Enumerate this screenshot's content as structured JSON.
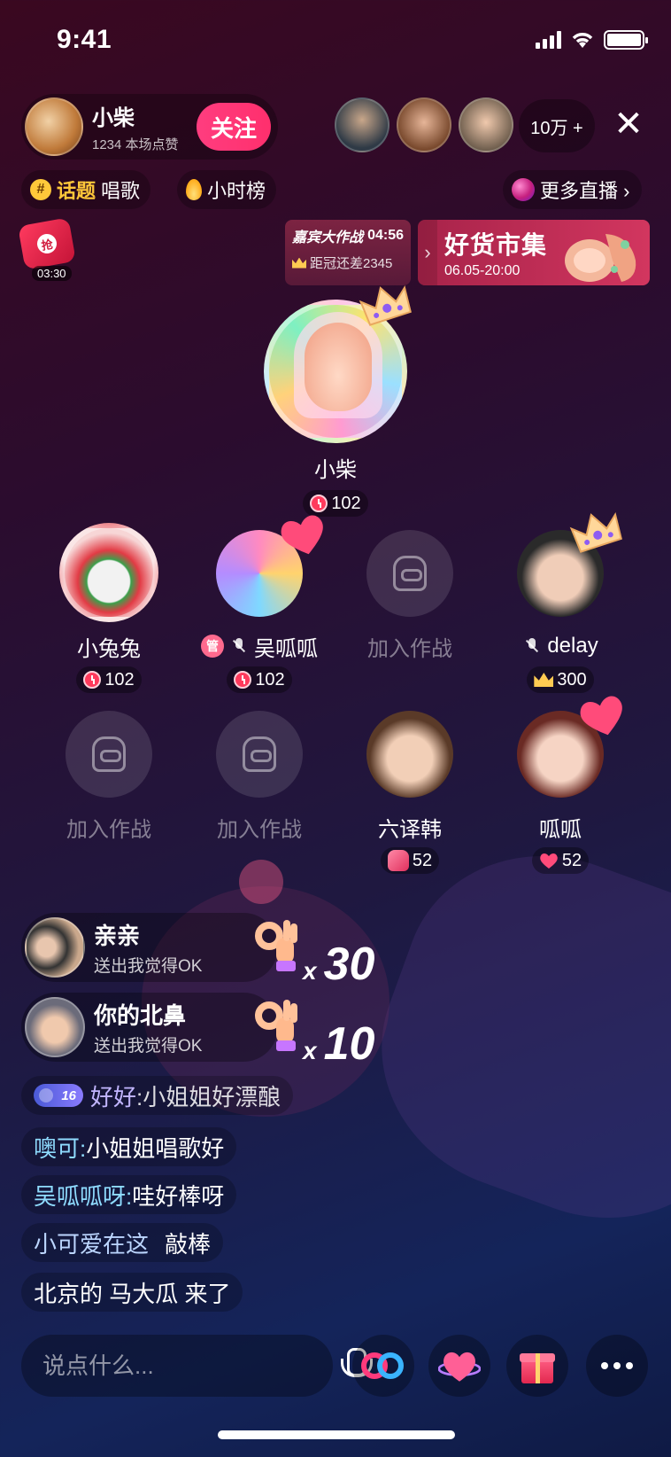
{
  "status": {
    "time": "9:41"
  },
  "host": {
    "name": "小柴",
    "likes": "1234 本场点赞",
    "follow_label": "关注"
  },
  "viewers": {
    "count": "10万 +"
  },
  "topic": {
    "key": "话题",
    "value": "唱歌"
  },
  "hot_rank": {
    "label": "小时榜"
  },
  "more_live": {
    "label": "更多直播 ›"
  },
  "envelope": {
    "seal": "抢",
    "timer": "03:30"
  },
  "battle": {
    "title": "嘉宾大作战",
    "time": "04:56",
    "desc": "距冠还差2345"
  },
  "market": {
    "title": "好货市集",
    "date": "06.05-20:00"
  },
  "host_seat": {
    "name": "小柴",
    "score": "102"
  },
  "seats": [
    {
      "name": "小兔兔",
      "score": "102"
    },
    {
      "badge": "管",
      "name": "吴呱呱",
      "score": "102"
    },
    {
      "empty_label": "加入作战"
    },
    {
      "name": "delay",
      "score": "300"
    },
    {
      "empty_label": "加入作战"
    },
    {
      "empty_label": "加入作战"
    },
    {
      "name": "六译韩",
      "score": "52"
    },
    {
      "name": "呱呱",
      "score": "52"
    }
  ],
  "gifts": [
    {
      "user": "亲亲",
      "message": "送出我觉得OK",
      "x": "x",
      "count": "30"
    },
    {
      "user": "你的北鼻",
      "message": "送出我觉得OK",
      "x": "x",
      "count": "10"
    }
  ],
  "chat": [
    {
      "level": "16",
      "user": "好好",
      "message": ":小姐姐好漂酿"
    },
    {
      "user": "噢可:",
      "message": "小姐姐唱歌好"
    },
    {
      "user": "吴呱呱呀:",
      "message": "哇好棒呀"
    },
    {
      "user": "小可爱在这",
      "message": "敲棒"
    },
    {
      "message": "北京的 马大瓜 来了"
    }
  ],
  "input": {
    "placeholder": "说点什么..."
  },
  "colors": {
    "accent": "#ff2f6d",
    "gold": "#ffc83a",
    "chat_user": "#8fdcff"
  }
}
